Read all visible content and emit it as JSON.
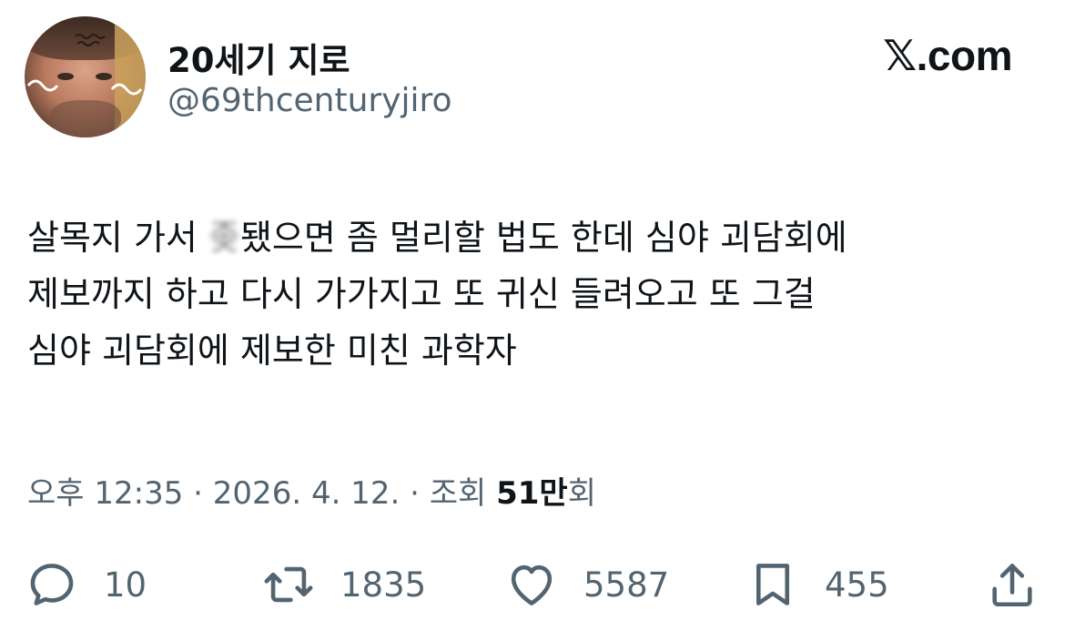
{
  "author": {
    "display_name": "20세기 지로",
    "handle": "@69thcenturyjiro",
    "avatar_icon": "profile-photo"
  },
  "brand": {
    "label": "𝕏.com"
  },
  "tweet": {
    "line1_before": "살목지 가서 ",
    "line1_censored": "좆",
    "line1_after": "됐으면 좀 멀리할 법도 한데 심야 괴담회에",
    "line2": "제보까지 하고 다시 가가지고 또 귀신 들려오고 또 그걸",
    "line3": "심야 괴담회에 제보한 미친 과학자"
  },
  "meta": {
    "time": "오후 12:35",
    "sep1": " · ",
    "date": "2026. 4. 12.",
    "sep2": " · ",
    "views_prefix": "조회 ",
    "views_count": "51만",
    "views_suffix": "회"
  },
  "actions": {
    "reply": {
      "icon": "reply-icon",
      "count": "10"
    },
    "retweet": {
      "icon": "retweet-icon",
      "count": "1835"
    },
    "like": {
      "icon": "heart-icon",
      "count": "5587"
    },
    "bookmark": {
      "icon": "bookmark-icon",
      "count": "455"
    },
    "share": {
      "icon": "share-icon"
    }
  },
  "colors": {
    "text": "#0f1419",
    "secondary": "#536471",
    "background": "#ffffff"
  }
}
